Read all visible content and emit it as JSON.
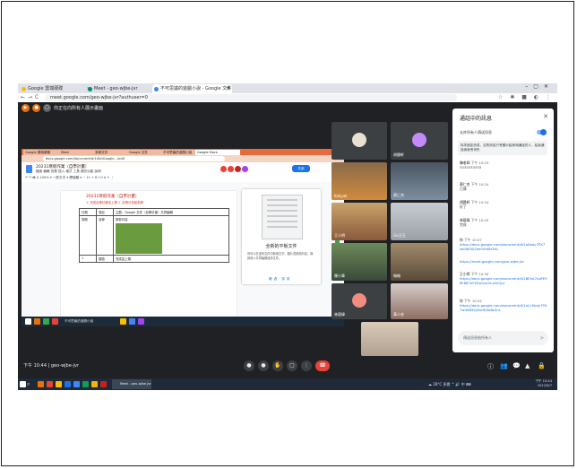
{
  "browser": {
    "tabs": [
      {
        "label": "Google 雲端硬碟",
        "favicon_color": "#fbbc04"
      },
      {
        "label": "Meet - geo-wjbe-jvr",
        "favicon_color": "#00897b"
      },
      {
        "label": "不可思議的遊戲小說 - Google 文件",
        "favicon_color": "#4285f4"
      }
    ],
    "new_tab": "+",
    "url": "meet.google.com/geo-wjbe-jvr?authuser=0",
    "nav": {
      "back": "←",
      "forward": "→",
      "reload": "C"
    },
    "right_icons": "☆ ✱ ■ ◐ ⋮"
  },
  "meet": {
    "presenting_label": "你正在向所有人展示畫面",
    "meeting_code": "geo-wjbe-jvr",
    "time": "下午 10:44",
    "time_sep": "|",
    "controls": {
      "mic": "●",
      "cam": "●",
      "hand": "✋",
      "present": "▢",
      "more": "⋮",
      "leave": "☎"
    },
    "right_controls": {
      "info": "ⓘ",
      "people": "👥",
      "chat": "💬",
      "activities": "▲",
      "lock": "🔒"
    }
  },
  "shared_screen": {
    "tabs": [
      "Google 雲端硬碟",
      "Meet",
      "多數文件",
      "Google 文件",
      "不可思議的遊戲小說",
      "Google Docs"
    ],
    "url": "docs.google.com/document/d/1XbhGoogle.../edit",
    "doc_title": "20231寒假作業（自學計畫）",
    "doc_menu": "檔案 編輯 查看 插入 格式 工具 擴充功能 說明",
    "toolbar": "↶ ↷ 🖶 A 100% ▾ 一般文字 ▾ 標楷體 ▾ − 11 + B I U A ✎ ⋮",
    "share_label": "共用",
    "page_title": "20231寒假作業（自學計畫）",
    "page_subtitle": "1. 完成自學計畫並上傳 2. 記得分享給老師",
    "table": [
      {
        "c1": "日期",
        "c2": "項目",
        "c3": "主題：Google 文件（自學計畫）共同編輯"
      },
      {
        "c1": "寒假",
        "c2": "自學",
        "c3": "撰寫內容"
      },
      {
        "c1": "1",
        "c2": "閱讀",
        "c3": "完成並上傳"
      }
    ],
    "panel": {
      "title": "全新的平板文件",
      "text": "你可以在這份文件中新增文字、圖片或其他內容，與其他人共同編輯這份文件。",
      "buttons": "略過    試用"
    },
    "taskbar_text": "不可思議的遊戲小說"
  },
  "participants": [
    {
      "name": "",
      "avatar_color": "#e8e0d0"
    },
    {
      "name": "胡晨軒",
      "avatar_color": "#c58af9"
    },
    {
      "name": "Kaliyah",
      "avatar_color": "#d08b3c"
    },
    {
      "name": "蔡仁杰",
      "avatar_color": "#7c8fa0"
    },
    {
      "name": "王小明",
      "avatar_color": "#c9a36b"
    },
    {
      "name": "Go汪汪",
      "avatar_color": "#9aa0a6"
    },
    {
      "name": "陳小華",
      "avatar_color": "#6d8a5a"
    },
    {
      "name": "翰翰",
      "avatar_color": "#a08c6a"
    },
    {
      "name": "林宸緯",
      "avatar_color": "#f28b82"
    },
    {
      "name": "黃小芸",
      "avatar_color": "#8d6e63"
    },
    {
      "name": "",
      "avatar_color": "#b0a090"
    }
  ],
  "chat": {
    "title": "通話中的訊息",
    "close": "✕",
    "toggle_label": "允許所有人傳送訊息",
    "note": "除非固定訊息，否則訊息只會顯示給參與通話的人，結束通話後就會消失",
    "messages": [
      {
        "who": "陳老師",
        "time": "下午 10:23",
        "text": "3333333333",
        "link": ""
      },
      {
        "who": "蔡仁杰",
        "time": "下午 10:24",
        "text": "已傳",
        "link": ""
      },
      {
        "who": "胡晨軒",
        "time": "下午 10:24",
        "text": "好了",
        "link": ""
      },
      {
        "who": "林宸緯",
        "time": "下午 10:25",
        "text": "完成",
        "link": ""
      },
      {
        "who": "你",
        "time": "下午 10:27",
        "text": "",
        "link": "https://docs.google.com/document/d/1aXbdy7PX7wd4B5Sj2ke9Ufa8z3nL"
      },
      {
        "who": "",
        "time": "",
        "text": "",
        "link": "https://meet.google.com/geo-wjbe-jvr"
      },
      {
        "who": "王小明",
        "time": "下午 10:30",
        "text": "",
        "link": "https://docs.google.com/document/d/1BEhA7cqPE98F8B7oFZ5wQxUrLsZnQxJ"
      },
      {
        "who": "你",
        "time": "下午 10:32",
        "text": "",
        "link": "https://docs.google.com/document/d/1aL1Xbdy7PX7wd4B5Sj2ke9Ufa8z3nL"
      }
    ],
    "input_placeholder": "傳送訊息給所有人",
    "send": "➤"
  },
  "windows_taskbar": {
    "search": "⌕",
    "active_window": "Meet - geo-wjbe-jvr",
    "tray": "☁ 28°C 多雲 ^ 🔊 中 ⌨",
    "clock_time": "下午 10:44",
    "clock_date": "2022/8/7"
  }
}
